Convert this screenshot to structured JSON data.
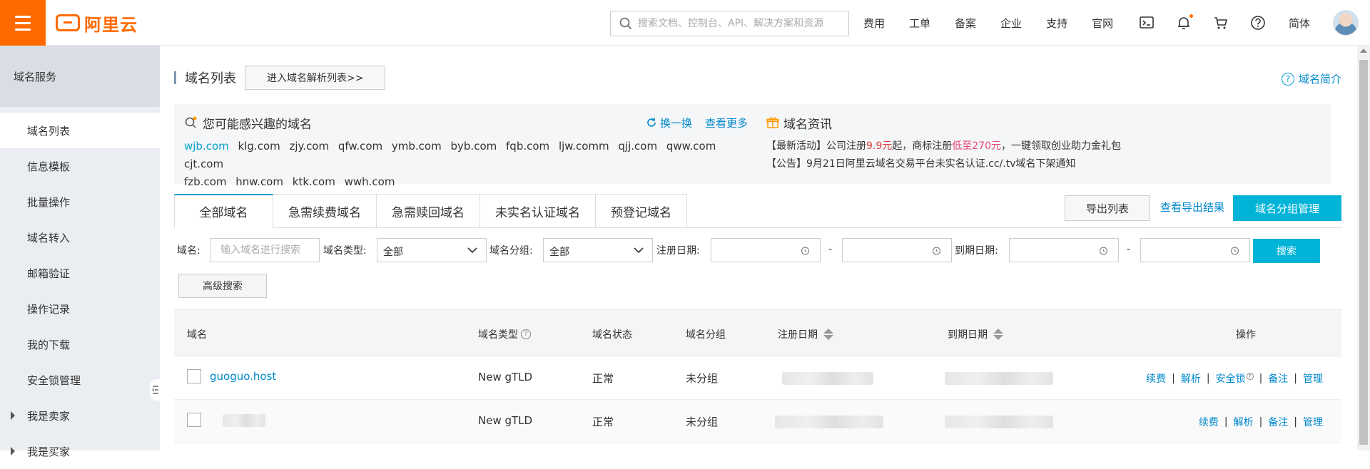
{
  "header": {
    "logo_text": "阿里云",
    "search_placeholder": "搜索文档、控制台、API、解决方案和资源",
    "nav": [
      "费用",
      "工单",
      "备案",
      "企业",
      "支持",
      "官网"
    ],
    "lang": "简体",
    "accent_color": "#ff6a00"
  },
  "sidebar": {
    "section_title": "域名服务",
    "items": [
      {
        "label": "域名列表",
        "active": true
      },
      {
        "label": "信息模板"
      },
      {
        "label": "批量操作"
      },
      {
        "label": "域名转入"
      },
      {
        "label": "邮箱验证"
      },
      {
        "label": "操作记录"
      },
      {
        "label": "我的下载"
      },
      {
        "label": "安全锁管理"
      },
      {
        "label": "我是卖家",
        "expandable": true
      },
      {
        "label": "我是买家",
        "expandable": true
      }
    ]
  },
  "main": {
    "page_title": "域名列表",
    "enter_dns_button": "进入域名解析列表>>",
    "intro_link": "域名简介",
    "interest_panel": {
      "title": "您可能感兴趣的域名",
      "refresh": "换一换",
      "more": "查看更多",
      "domains": [
        "wjb.com",
        "klg.com",
        "zjy.com",
        "qfw.com",
        "ymb.com",
        "byb.com",
        "fqb.com",
        "ljw.comm",
        "qjj.com",
        "qww.com",
        "cjt.com",
        "fzb.com",
        "hnw.com",
        "ktk.com",
        "wwh.com"
      ]
    },
    "news_panel": {
      "title": "域名资讯",
      "line1": {
        "prefix": "【最新活动】公司注册",
        "price1": "9.9元",
        "mid": "起，商标注册",
        "price2": "低至270元",
        "suffix": "，一键领取创业助力金礼包"
      },
      "line2": "【公告】9月21日阿里云域名交易平台未实名认证.cc/.tv域名下架通知"
    },
    "tabs": [
      "全部域名",
      "急需续费域名",
      "急需赎回域名",
      "未实名认证域名",
      "预登记域名"
    ],
    "export_button": "导出列表",
    "view_export_link": "查看导出结果",
    "group_manage_button": "域名分组管理",
    "filters": {
      "domain_label": "域名:",
      "domain_placeholder": "输入域名进行搜索",
      "type_label": "域名类型:",
      "type_value": "全部",
      "group_label": "域名分组:",
      "group_value": "全部",
      "reg_date_label": "注册日期:",
      "exp_date_label": "到期日期:",
      "dash": "-",
      "search_button": "搜索",
      "advanced_button": "高级搜索"
    },
    "table": {
      "headers": {
        "domain": "域名",
        "type": "域名类型",
        "status": "域名状态",
        "group": "域名分组",
        "reg": "注册日期",
        "exp": "到期日期",
        "ops": "操作"
      },
      "rows": [
        {
          "domain": "guoguo.host",
          "type": "New gTLD",
          "status": "正常",
          "group": "未分组",
          "ops": [
            "续费",
            "解析",
            "安全锁",
            "备注",
            "管理"
          ]
        },
        {
          "domain": "",
          "type": "New gTLD",
          "status": "正常",
          "group": "未分组",
          "ops": [
            "续费",
            "解析",
            "备注",
            "管理"
          ]
        }
      ]
    }
  }
}
